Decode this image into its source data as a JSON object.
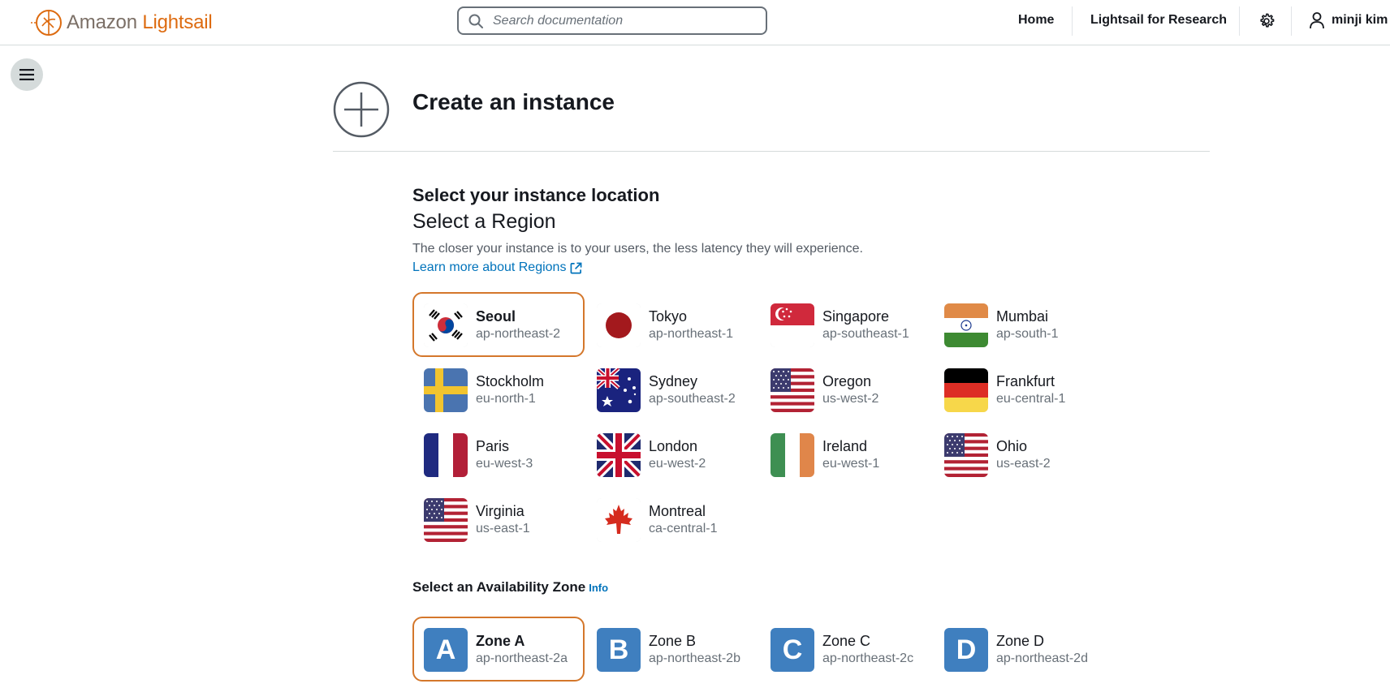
{
  "header": {
    "logo_brand": "Amazon",
    "logo_product": "Lightsail",
    "search_placeholder": "Search documentation",
    "nav_home": "Home",
    "nav_research": "Lightsail for Research",
    "user_name": "minji kim"
  },
  "page": {
    "title": "Create an instance",
    "section_title": "Select your instance location",
    "region_heading": "Select a Region",
    "description": "The closer your instance is to your users, the less latency they will experience.",
    "learn_more": "Learn more about Regions",
    "az_title": "Select an Availability Zone",
    "az_info": "Info"
  },
  "regions": [
    {
      "name": "Seoul",
      "code": "ap-northeast-2",
      "flag": "kr-flag",
      "selected": true
    },
    {
      "name": "Tokyo",
      "code": "ap-northeast-1",
      "flag": "jp-flag"
    },
    {
      "name": "Singapore",
      "code": "ap-southeast-1",
      "flag": "sg-flag"
    },
    {
      "name": "Mumbai",
      "code": "ap-south-1",
      "flag": "in-flag"
    },
    {
      "name": "Stockholm",
      "code": "eu-north-1",
      "flag": "se-flag"
    },
    {
      "name": "Sydney",
      "code": "ap-southeast-2",
      "flag": "au-flag"
    },
    {
      "name": "Oregon",
      "code": "us-west-2",
      "flag": "us-flag"
    },
    {
      "name": "Frankfurt",
      "code": "eu-central-1",
      "flag": "de-flag"
    },
    {
      "name": "Paris",
      "code": "eu-west-3",
      "flag": "fr-flag"
    },
    {
      "name": "London",
      "code": "eu-west-2",
      "flag": "gb-flag"
    },
    {
      "name": "Ireland",
      "code": "eu-west-1",
      "flag": "ie-flag"
    },
    {
      "name": "Ohio",
      "code": "us-east-2",
      "flag": "us-flag"
    },
    {
      "name": "Virginia",
      "code": "us-east-1",
      "flag": "us-flag"
    },
    {
      "name": "Montreal",
      "code": "ca-central-1",
      "flag": "ca-flag"
    }
  ],
  "zones": [
    {
      "letter": "A",
      "name": "Zone A",
      "code": "ap-northeast-2a",
      "selected": true
    },
    {
      "letter": "B",
      "name": "Zone B",
      "code": "ap-northeast-2b"
    },
    {
      "letter": "C",
      "name": "Zone C",
      "code": "ap-northeast-2c"
    },
    {
      "letter": "D",
      "name": "Zone D",
      "code": "ap-northeast-2d"
    }
  ],
  "colors": {
    "brand_orange": "#dd6b10",
    "selected_border": "#d4772b",
    "link_blue": "#0073bb",
    "zone_blue": "#3f7fbf"
  }
}
